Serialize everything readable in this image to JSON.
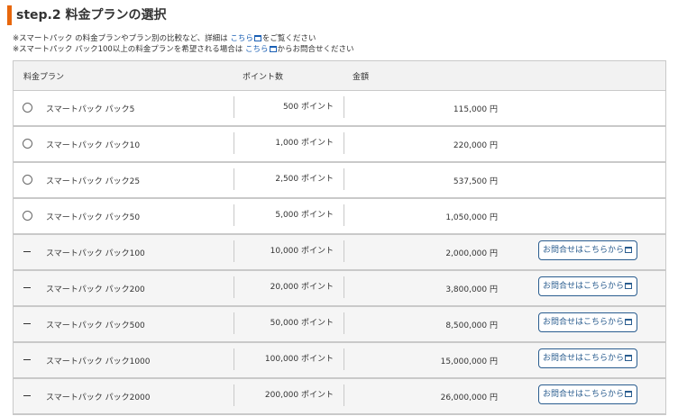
{
  "section": {
    "title": "step.2 料金プランの選択"
  },
  "notes": [
    {
      "before": "※スマートパック の料金プランやプラン別の比較など、詳細は ",
      "link": "こちら",
      "after": "をご覧ください"
    },
    {
      "before": "※スマートパック パック100以上の料金プランを希望される場合は ",
      "link": "こちら",
      "after": "からお問合せください"
    }
  ],
  "table": {
    "headers": {
      "plan": "料金プラン",
      "points": "ポイント数",
      "price": "金額"
    },
    "rows": [
      {
        "type": "radio",
        "name": "スマートパック パック5",
        "points": "500 ポイント",
        "price": "115,000 円"
      },
      {
        "type": "radio",
        "name": "スマートパック パック10",
        "points": "1,000 ポイント",
        "price": "220,000 円"
      },
      {
        "type": "radio",
        "name": "スマートパック パック25",
        "points": "2,500 ポイント",
        "price": "537,500 円"
      },
      {
        "type": "radio",
        "name": "スマートパック パック50",
        "points": "5,000 ポイント",
        "price": "1,050,000 円"
      },
      {
        "type": "contact",
        "name": "スマートパック パック100",
        "points": "10,000 ポイント",
        "price": "2,000,000 円",
        "button": "お問合せはこちらから"
      },
      {
        "type": "contact",
        "name": "スマートパック パック200",
        "points": "20,000 ポイント",
        "price": "3,800,000 円",
        "button": "お問合せはこちらから"
      },
      {
        "type": "contact",
        "name": "スマートパック パック500",
        "points": "50,000 ポイント",
        "price": "8,500,000 円",
        "button": "お問合せはこちらから"
      },
      {
        "type": "contact",
        "name": "スマートパック パック1000",
        "points": "100,000 ポイント",
        "price": "15,000,000 円",
        "button": "お問合せはこちらから"
      },
      {
        "type": "contact",
        "name": "スマートパック パック2000",
        "points": "200,000 ポイント",
        "price": "26,000,000 円",
        "button": "お問合せはこちらから"
      }
    ]
  },
  "colors": {
    "accent": "#e8670c",
    "link": "#1a5fb4",
    "button": "#2a5d8f",
    "border": "#c9c9c9"
  },
  "icons": {
    "link": "external-window-icon",
    "button": "external-window-icon"
  }
}
